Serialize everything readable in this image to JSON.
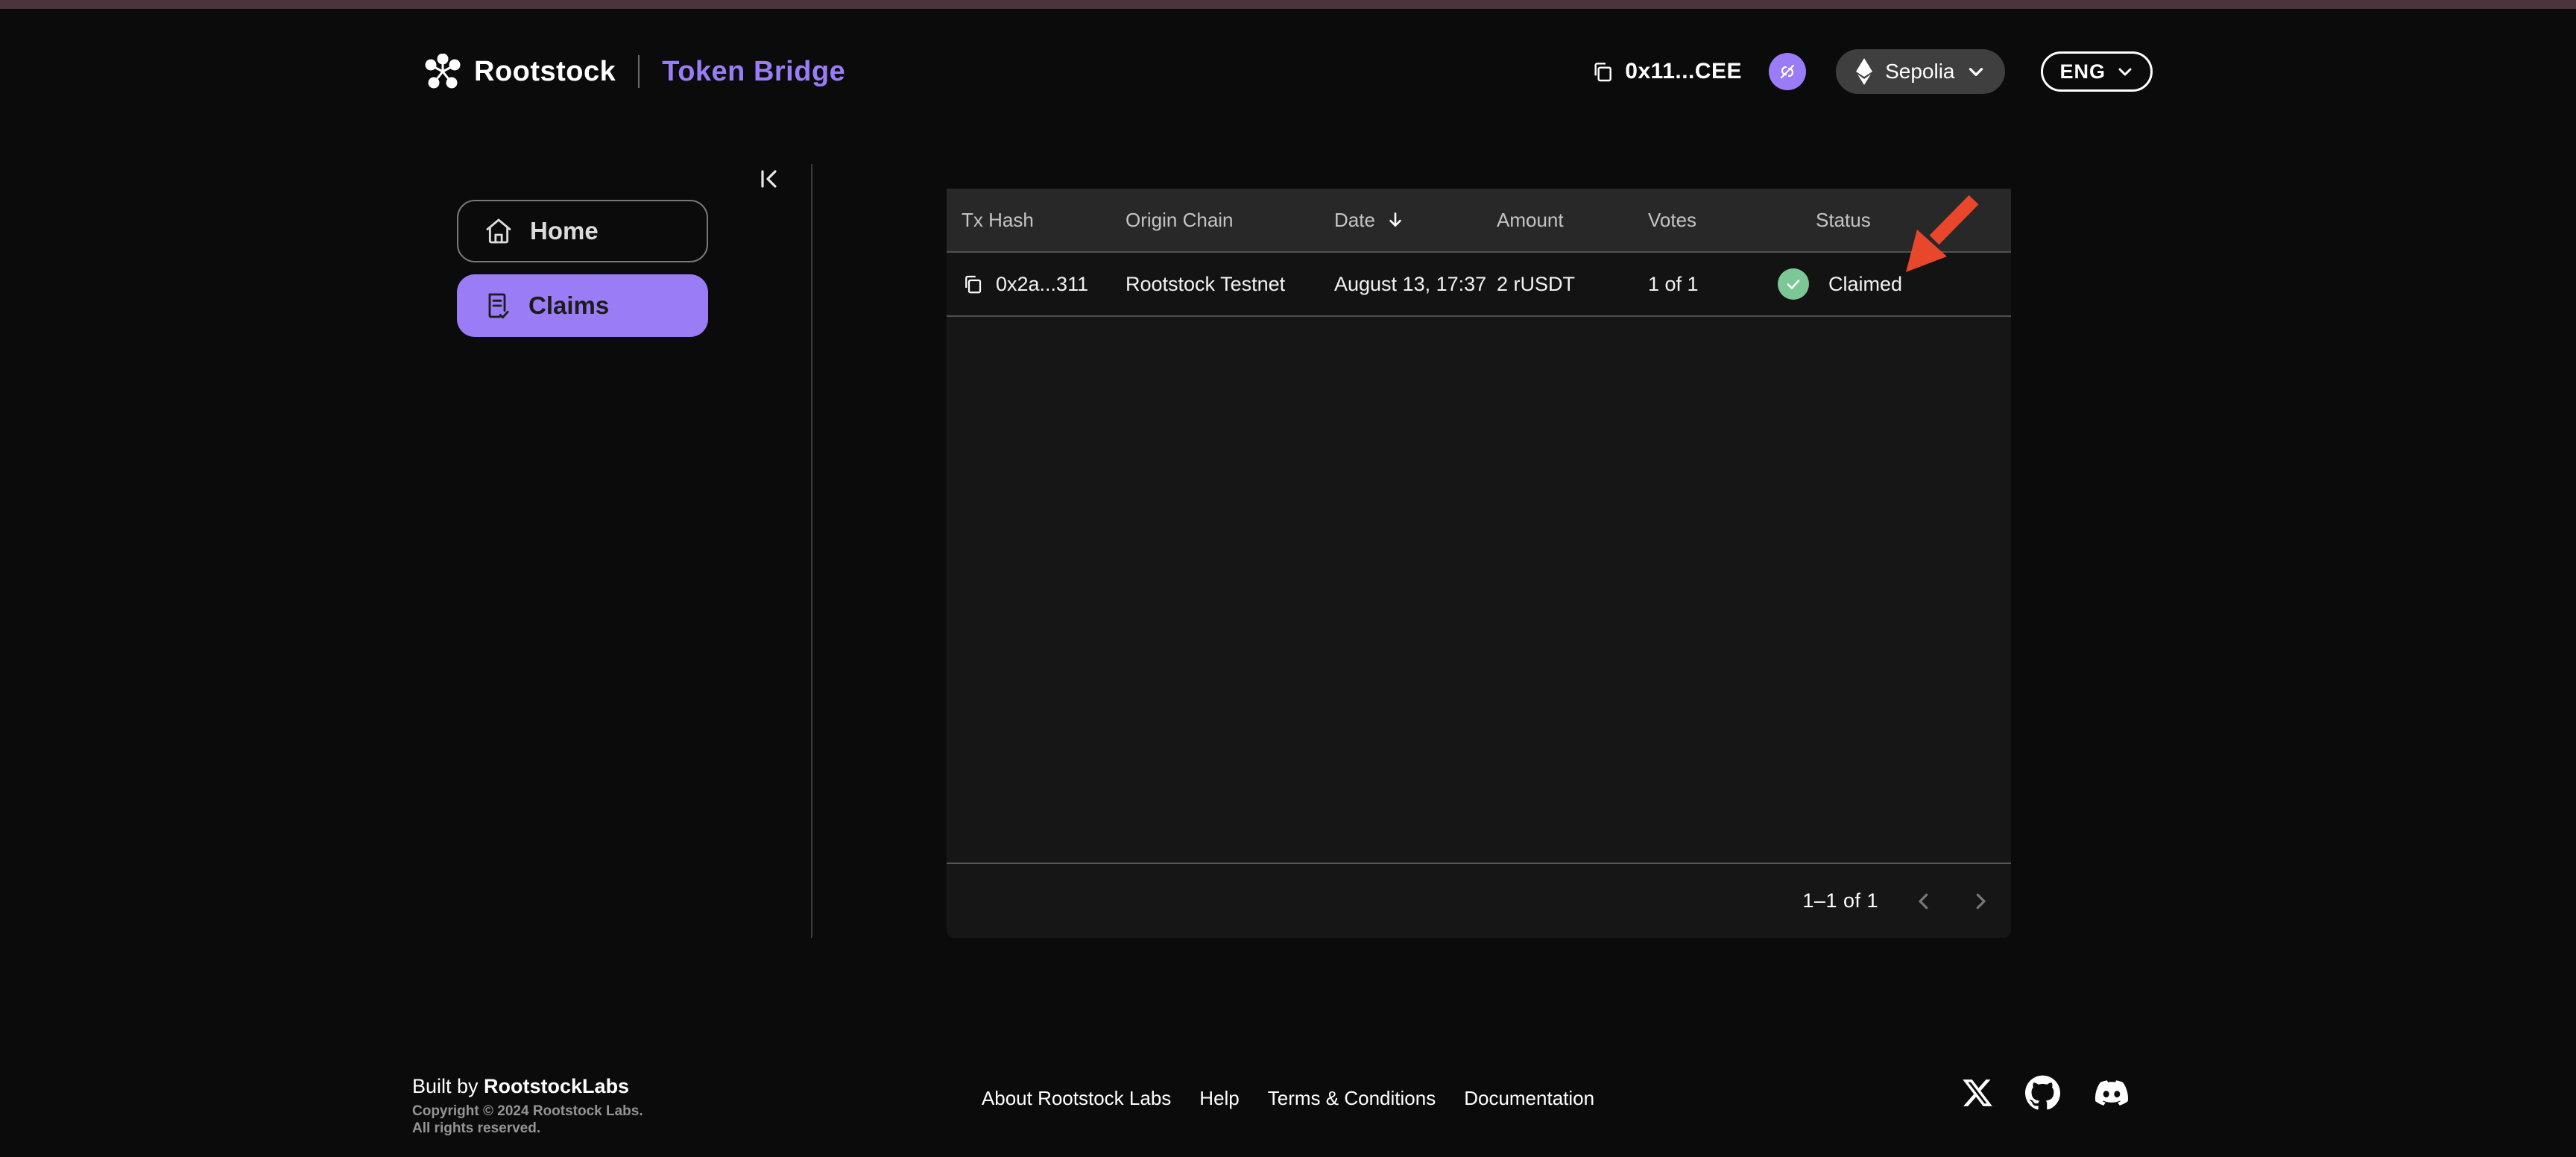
{
  "header": {
    "brand": {
      "name": "Rootstock",
      "product": "Token Bridge"
    },
    "wallet": {
      "address": "0x11...CEE",
      "copy_icon": "copy-icon",
      "disconnect_icon": "broken-link-icon"
    },
    "network": {
      "label": "Sepolia",
      "icon": "ethereum-icon"
    },
    "language": {
      "label": "ENG"
    }
  },
  "sidebar": {
    "collapse_icon": "collapse-panel-icon",
    "items": [
      {
        "label": "Home",
        "icon": "home-icon",
        "active": false
      },
      {
        "label": "Claims",
        "icon": "claims-document-icon",
        "active": true
      }
    ]
  },
  "claims_table": {
    "columns": [
      "Tx Hash",
      "Origin Chain",
      "Date",
      "Amount",
      "Votes",
      "Status"
    ],
    "sort": {
      "column": "Date",
      "direction": "desc",
      "icon": "sort-desc-arrow-icon"
    },
    "rows": [
      {
        "tx_hash": "0x2a...311",
        "origin_chain": "Rootstock Testnet",
        "date": "August 13, 17:37",
        "amount": "2 rUSDT",
        "votes": "1 of 1",
        "status": "Claimed",
        "status_icon": "check-circle-icon"
      }
    ],
    "pagination": {
      "label": "1–1 of 1",
      "prev_icon": "chevron-left-icon",
      "next_icon": "chevron-right-icon"
    }
  },
  "annotation": {
    "type": "arrow",
    "points_to": "Claimed status",
    "color": "#e8472b"
  },
  "footer": {
    "built_by": "Built by ",
    "built_by_brand": "RootstockLabs",
    "copyright_line1": "Copyright © 2024 Rootstock Labs.",
    "copyright_line2": "All rights reserved.",
    "links": [
      "About Rootstock Labs",
      "Help",
      "Terms & Conditions",
      "Documentation"
    ],
    "socials": [
      "x-icon",
      "github-icon",
      "discord-icon"
    ]
  },
  "colors": {
    "accent": "#9a7cf7",
    "success": "#7cc796",
    "arrow": "#e8472b",
    "top_strip": "#4b343b"
  }
}
